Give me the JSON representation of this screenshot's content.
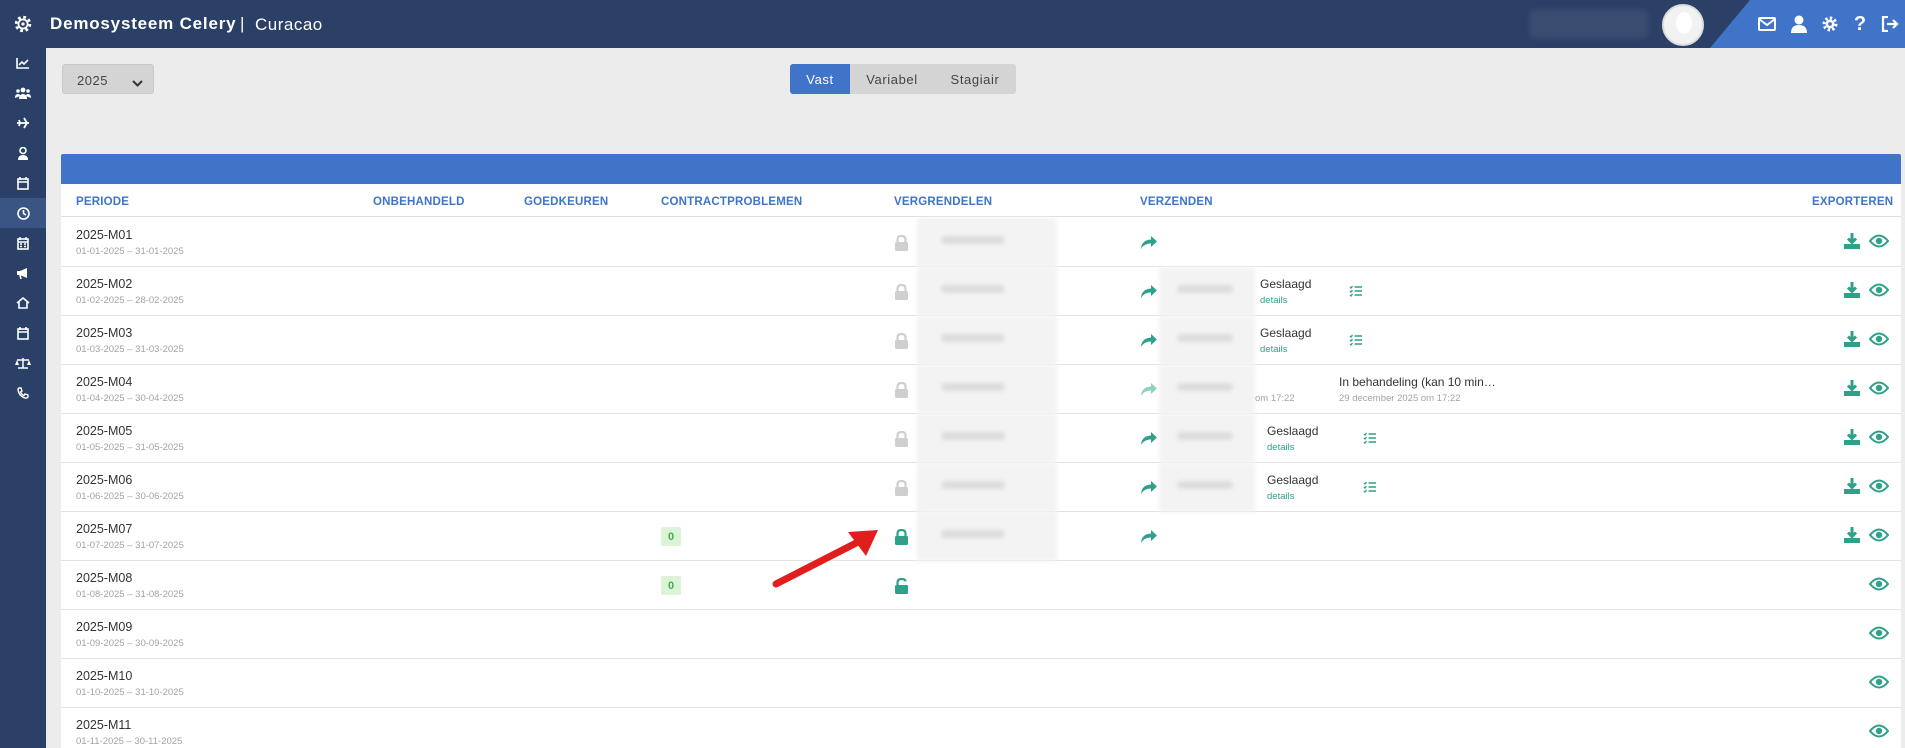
{
  "app": {
    "title": "Demosysteem Celery",
    "separator": "|",
    "organization": "Curacao"
  },
  "controls": {
    "year": "2025",
    "tabs": [
      "Vast",
      "Variabel",
      "Stagiair"
    ],
    "active_tab": "Vast"
  },
  "table": {
    "headers": {
      "periode": "PERIODE",
      "onbehandeld": "ONBEHANDELD",
      "goedkeuren": "GOEDKEUREN",
      "contractproblemen": "CONTRACTPROBLEMEN",
      "vergrendelen": "VERGRENDELEN",
      "verzenden": "VERZENDEN",
      "exporteren": "EXPORTEREN"
    },
    "rows": [
      {
        "period": "2025-M01",
        "range": "01-01-2025 – 31-01-2025",
        "lock": "locked-grey",
        "send": true,
        "status": "",
        "details": "",
        "export": true
      },
      {
        "period": "2025-M02",
        "range": "01-02-2025 – 28-02-2025",
        "lock": "locked-grey",
        "send": true,
        "status": "Geslaagd",
        "details": "details",
        "export": true
      },
      {
        "period": "2025-M03",
        "range": "01-03-2025 – 31-03-2025",
        "lock": "locked-grey",
        "send": true,
        "status": "Geslaagd",
        "details": "details",
        "export": true
      },
      {
        "period": "2025-M04",
        "range": "01-04-2025 – 30-04-2025",
        "lock": "locked-grey",
        "send": true,
        "status_pending": "In behandeling (kan 10 min…",
        "pending_time": "29 december 2025 om 17:22",
        "partial_time": "om 17:22",
        "export": true
      },
      {
        "period": "2025-M05",
        "range": "01-05-2025 – 31-05-2025",
        "lock": "locked-grey",
        "send": true,
        "status": "Geslaagd",
        "details": "details",
        "export": true
      },
      {
        "period": "2025-M06",
        "range": "01-06-2025 – 30-06-2025",
        "lock": "locked-grey",
        "send": true,
        "status": "Geslaagd",
        "details": "details",
        "export": true
      },
      {
        "period": "2025-M07",
        "range": "01-07-2025 – 31-07-2025",
        "contract_problems": "0",
        "lock": "locked-green",
        "send": true,
        "export": true
      },
      {
        "period": "2025-M08",
        "range": "01-08-2025 – 31-08-2025",
        "contract_problems": "0",
        "lock": "unlocked-green",
        "send": false,
        "export": false
      },
      {
        "period": "2025-M09",
        "range": "01-09-2025 – 30-09-2025",
        "export": false
      },
      {
        "period": "2025-M10",
        "range": "01-10-2025 – 31-10-2025",
        "export": false
      },
      {
        "period": "2025-M11",
        "range": "01-11-2025 – 30-11-2025",
        "export": false
      }
    ]
  },
  "colors": {
    "header_bg": "#2b4066",
    "accent_blue": "#3f74c9",
    "teal": "#2fa08a",
    "annotation_arrow": "#e01e1e"
  }
}
